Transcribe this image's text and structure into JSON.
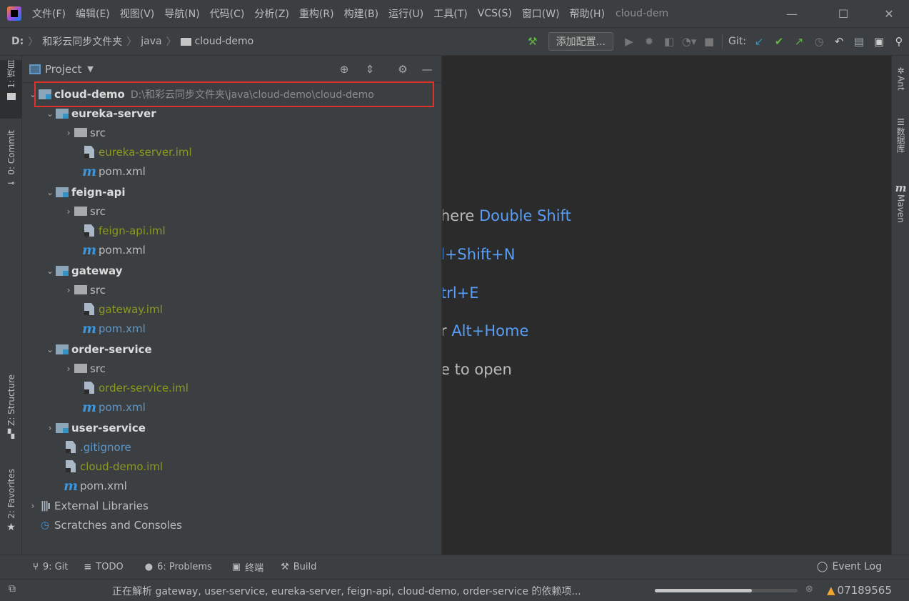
{
  "menu": {
    "items": [
      "文件(F)",
      "编辑(E)",
      "视图(V)",
      "导航(N)",
      "代码(C)",
      "分析(Z)",
      "重构(R)",
      "构建(B)",
      "运行(U)",
      "工具(T)",
      "VCS(S)",
      "窗口(W)",
      "帮助(H)"
    ],
    "window_title": "cloud-dem",
    "controls": {
      "minimize": "—",
      "maximize": "☐",
      "close": "✕"
    }
  },
  "breadcrumb": {
    "drive": "D:",
    "parts": [
      "和彩云同步文件夹",
      "java",
      "cloud-demo"
    ],
    "separator": "〉"
  },
  "toolbar": {
    "add_config_label": "添加配置...",
    "git_label": "Git:"
  },
  "left_tabs": {
    "project": "1: 项目",
    "commit": "0: Commit",
    "structure": "Z: Structure",
    "favorites": "2: Favorites"
  },
  "right_tabs": {
    "ant": "Ant",
    "database": "数据库",
    "maven": "Maven"
  },
  "project_panel": {
    "title": "Project",
    "tree": [
      {
        "label": "cloud-demo",
        "path": "D:\\和彩云同步文件夹\\java\\cloud-demo\\cloud-demo",
        "arrow": "⌄",
        "icon": "module"
      },
      {
        "label": "eureka-server",
        "arrow": "⌄",
        "icon": "module"
      },
      {
        "label": "src",
        "arrow": "›",
        "icon": "folder"
      },
      {
        "label": "eureka-server.iml",
        "icon": "iml"
      },
      {
        "label": "pom.xml",
        "icon": "maven"
      },
      {
        "label": "feign-api",
        "arrow": "⌄",
        "icon": "module"
      },
      {
        "label": "src",
        "arrow": "›",
        "icon": "folder"
      },
      {
        "label": "feign-api.iml",
        "icon": "iml"
      },
      {
        "label": "pom.xml",
        "icon": "maven"
      },
      {
        "label": "gateway",
        "arrow": "⌄",
        "icon": "module"
      },
      {
        "label": "src",
        "arrow": "›",
        "icon": "folder"
      },
      {
        "label": "gateway.iml",
        "icon": "iml"
      },
      {
        "label": "pom.xml",
        "icon": "maven"
      },
      {
        "label": "order-service",
        "arrow": "⌄",
        "icon": "module"
      },
      {
        "label": "src",
        "arrow": "›",
        "icon": "folder"
      },
      {
        "label": "order-service.iml",
        "icon": "iml"
      },
      {
        "label": "pom.xml",
        "icon": "maven"
      },
      {
        "label": "user-service",
        "arrow": "›",
        "icon": "module"
      },
      {
        "label": ".gitignore",
        "icon": "gitignore"
      },
      {
        "label": "cloud-demo.iml",
        "icon": "iml"
      },
      {
        "label": "pom.xml",
        "icon": "maven"
      },
      {
        "label": "External Libraries",
        "arrow": "›",
        "icon": "libraries"
      },
      {
        "label": "Scratches and Consoles",
        "icon": "scratches"
      }
    ]
  },
  "editor_hints": [
    {
      "text": "here ",
      "key": "Double Shift"
    },
    {
      "text": "",
      "key": "l+Shift+N"
    },
    {
      "text": "",
      "key": "trl+E"
    },
    {
      "text": "r ",
      "key": "Alt+Home"
    },
    {
      "text": "e to open",
      "key": ""
    }
  ],
  "bottom_tabs": [
    {
      "icon": "git-icon",
      "glyph": "⑂",
      "label": "9: Git"
    },
    {
      "icon": "todo-icon",
      "glyph": "≡",
      "label": "TODO"
    },
    {
      "icon": "problems-icon",
      "glyph": "●",
      "label": "6: Problems"
    },
    {
      "icon": "terminal-icon",
      "glyph": "▣",
      "label": "终端"
    },
    {
      "icon": "build-icon",
      "glyph": "⚒",
      "label": "Build"
    }
  ],
  "event_log": "Event Log",
  "status": {
    "text": "正在解析 gateway, user-service, eureka-server, feign-api, cloud-demo, order-service 的依赖项...",
    "progress": 0.68,
    "warning_count": "07189565"
  },
  "colors": {
    "highlight_box": "#e1312c",
    "link_blue": "#589df6",
    "iml_text": "#8c9a1d"
  }
}
